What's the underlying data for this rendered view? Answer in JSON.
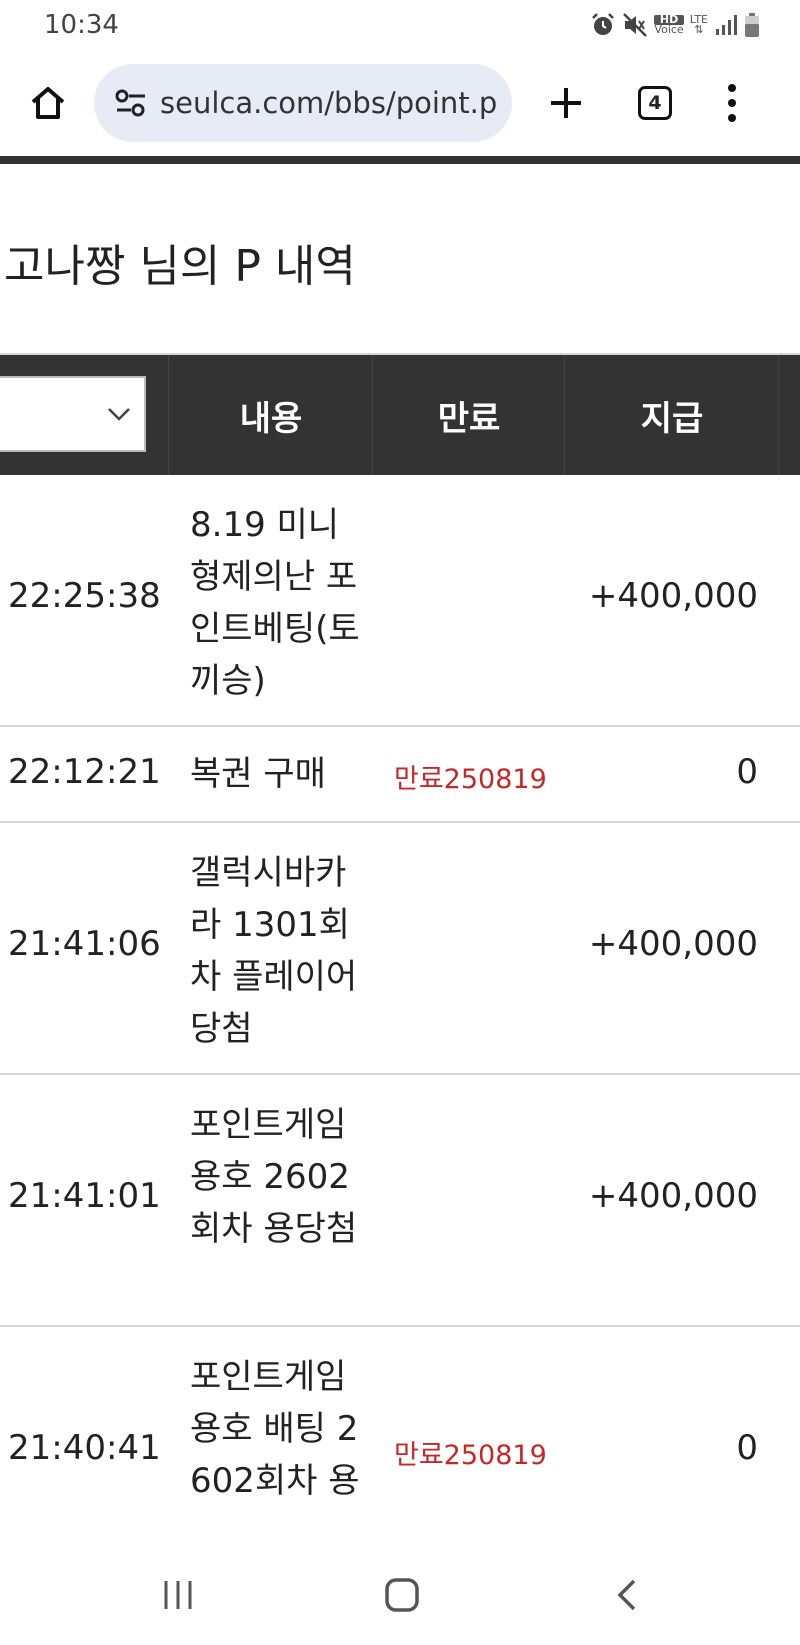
{
  "status": {
    "time": "10:34",
    "hd_label": "HD",
    "voice_label": "Voice",
    "lte_label": "LTE"
  },
  "browser": {
    "url": "seulca.com/bbs/point.php",
    "tab_count": "4"
  },
  "page": {
    "title": "고나짱 님의 P 내역"
  },
  "table": {
    "headers": {
      "content": "내용",
      "expire": "만료",
      "pay": "지급"
    },
    "rows": [
      {
        "time": "22:25:38",
        "content": "8.19 미니형제의난 포인트베팅(토끼승)",
        "expire": "",
        "pay": "+400,000"
      },
      {
        "time": "22:12:21",
        "content": "복권 구매",
        "expire": "만료250819",
        "pay": "0"
      },
      {
        "time": "21:41:06",
        "content": "갤럭시바카라 1301회차 플레이어당첨",
        "expire": "",
        "pay": "+400,000"
      },
      {
        "time": "21:41:01",
        "content": "포인트게임 용호 2602회차 용당첨",
        "expire": "",
        "pay": "+400,000"
      },
      {
        "time": "21:40:41",
        "content": "포인트게임 용호 배팅 2602회차 용",
        "expire": "만료250819",
        "pay": "0"
      }
    ]
  },
  "colors": {
    "header_bg": "#333333",
    "expire_red": "#c62828",
    "url_pill": "#e6ebf5"
  }
}
